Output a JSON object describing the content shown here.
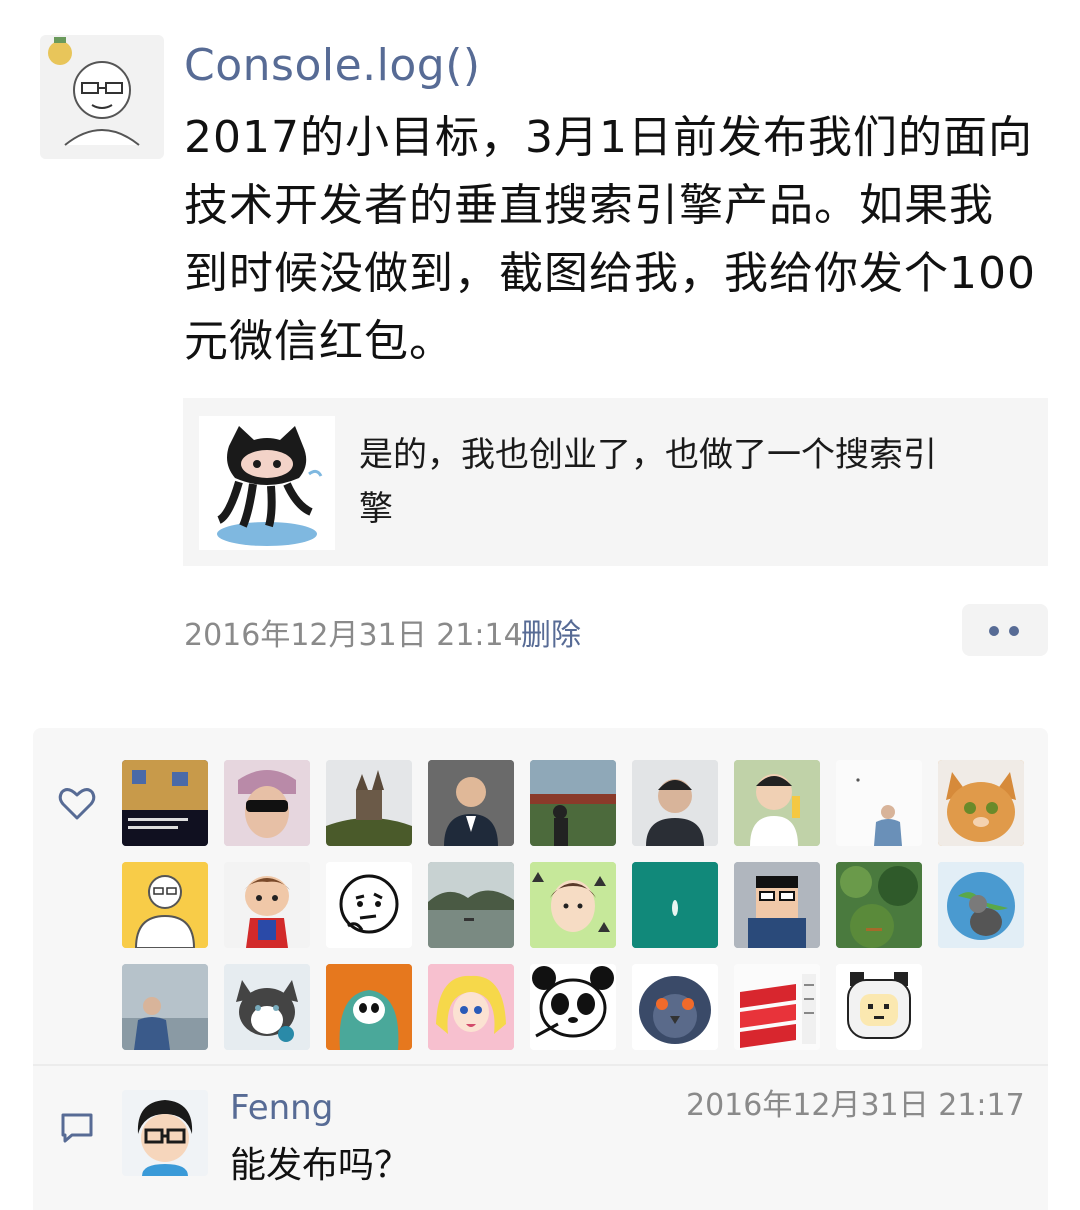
{
  "post": {
    "author": "Console.log()",
    "text_lines": [
      "2017的小目标，3月1日前发布我们的面向",
      "技术开发者的垂直搜索引擎产品。如果我",
      "到时候没做到，截图给我，我给你发个100",
      "元微信红包。"
    ],
    "shared_card": {
      "text_lines": [
        "是的，我也创业了，也做了一个搜索引",
        "擎"
      ],
      "thumbnail_icon": "octocat-icon"
    },
    "timestamp": "2016年12月31日 21:14",
    "delete_label": "删除",
    "more_icon": "more-dots-icon"
  },
  "likes": {
    "icon": "heart-icon",
    "count_shown": 26
  },
  "comment": {
    "icon": "comment-icon",
    "author": "Fenng",
    "timestamp": "2016年12月31日 21:17",
    "text": "能发布吗？"
  },
  "colors": {
    "link": "#576b95",
    "meta": "#8a8a8a",
    "panel": "#f7f7f7"
  }
}
